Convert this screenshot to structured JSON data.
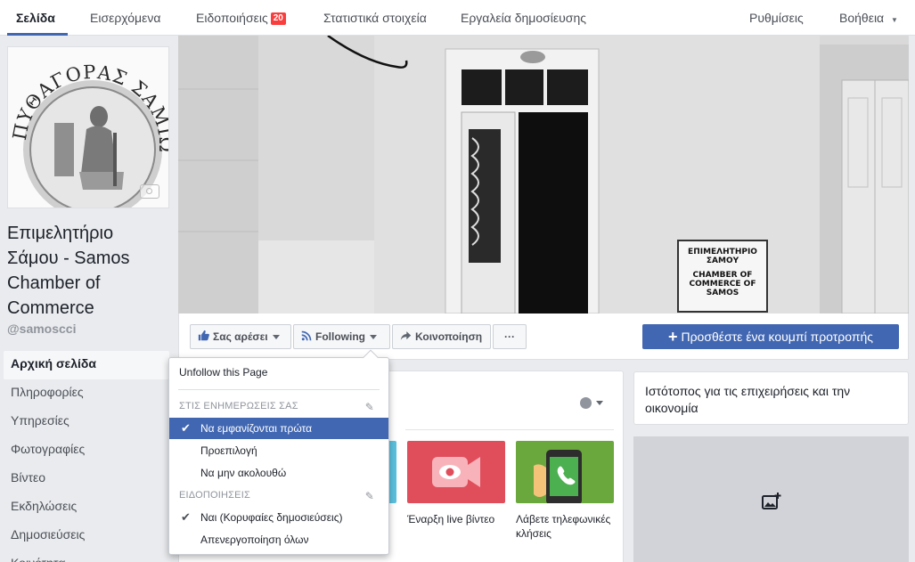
{
  "topnav": {
    "items": [
      {
        "label": "Σελίδα"
      },
      {
        "label": "Εισερχόμενα"
      },
      {
        "label": "Ειδοποιήσεις",
        "badge": "20"
      },
      {
        "label": "Στατιστικά στοιχεία"
      },
      {
        "label": "Εργαλεία δημοσίευσης"
      }
    ],
    "settings": "Ρυθμίσεις",
    "help": "Βοήθεια"
  },
  "profile": {
    "logo_top_text": "ΠΥΘΑΓΟΡΑΣ ΣΑΜΙΩΝ",
    "page_name": "Επιμελητήριο Σάμου - Samos Chamber of Commerce",
    "username": "@samoscci"
  },
  "leftnav": {
    "items": [
      "Αρχική σελίδα",
      "Πληροφορίες",
      "Υπηρεσίες",
      "Φωτογραφίες",
      "Βίντεο",
      "Εκδηλώσεις",
      "Δημοσιεύσεις",
      "Κοινότητα"
    ]
  },
  "cover": {
    "sign_lines": [
      "ΕΠΙΜΕΛΗΤΗΡΙΟ",
      "ΣΑΜΟΥ",
      "CHAMBER OF",
      "COMMERCE OF",
      "SAMOS"
    ]
  },
  "actions": {
    "like": "Σας αρέσει",
    "following": "Following",
    "share": "Κοινοποίηση",
    "more": "···",
    "cta": "Προσθέστε ένα κουμπί προτροπής"
  },
  "dropdown": {
    "unfollow": "Unfollow this Page",
    "section_feed": "ΣΤΙΣ ΕΝΗΜΕΡΩΣΕΙΣ ΣΑΣ",
    "feed_options": [
      "Να εμφανίζονται πρώτα",
      "Προεπιλογή",
      "Να μην ακολουθώ"
    ],
    "section_notifications": "ΕΙΔΟΠΟΙΗΣΕΙΣ",
    "notification_options": [
      "Ναι (Κορυφαίες δημοσιεύσεις)",
      "Απενεργοποίηση όλων"
    ]
  },
  "tiles": {
    "live": "Έναρξη live βίντεο",
    "calls": "Λάβετε τηλεφωνικές κλήσεις"
  },
  "right": {
    "category": "Ιστότοπος για τις επιχειρήσεις και την οικονομία"
  },
  "colors": {
    "brand": "#4267b2",
    "badge": "#fa3e3e",
    "tile_live": "#e04e5c",
    "tile_calls": "#6aa83e",
    "tile_partial": "#5bc0de"
  }
}
